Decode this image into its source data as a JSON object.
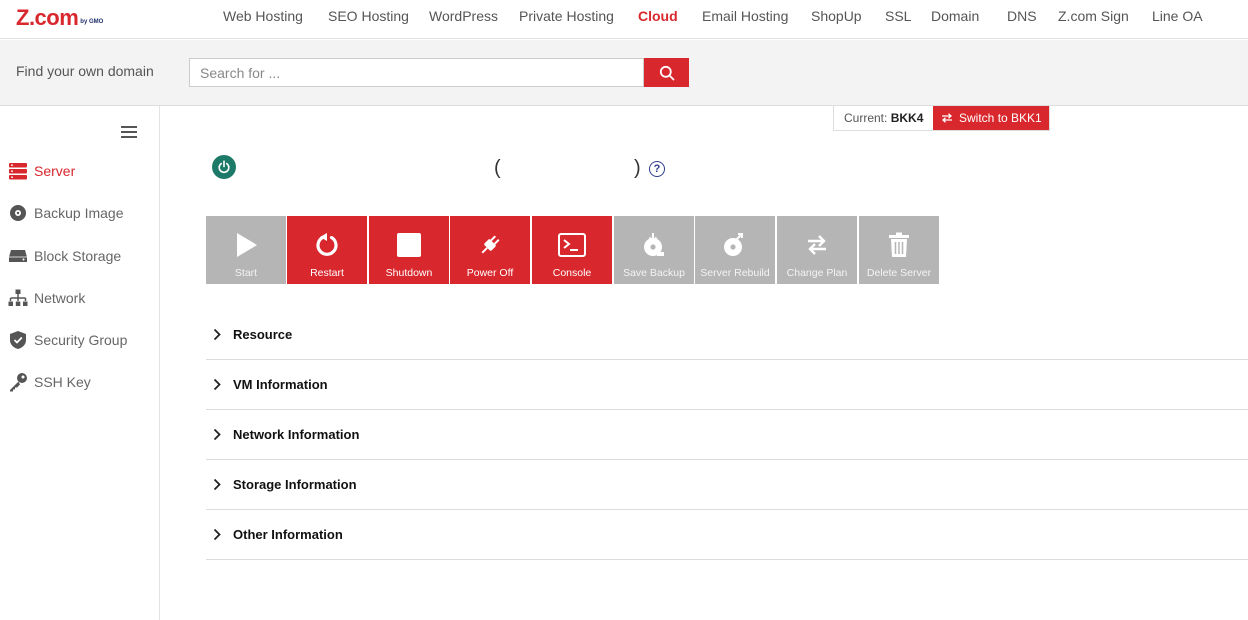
{
  "brand": {
    "logo": "Z.com",
    "logo_sub": "by GMO"
  },
  "nav": [
    {
      "label": "Web Hosting"
    },
    {
      "label": "SEO Hosting"
    },
    {
      "label": "WordPress"
    },
    {
      "label": "Private Hosting"
    },
    {
      "label": "Cloud",
      "active": true
    },
    {
      "label": "Email Hosting"
    },
    {
      "label": "ShopUp"
    },
    {
      "label": "SSL"
    },
    {
      "label": "Domain"
    },
    {
      "label": "DNS"
    },
    {
      "label": "Z.com Sign"
    },
    {
      "label": "Line OA"
    }
  ],
  "search": {
    "label": "Find your own domain",
    "placeholder": "Search for ..."
  },
  "sidebar": {
    "items": [
      {
        "label": "Server",
        "icon": "server-icon",
        "active": true
      },
      {
        "label": "Backup Image",
        "icon": "disc-icon"
      },
      {
        "label": "Block Storage",
        "icon": "storage-icon"
      },
      {
        "label": "Network",
        "icon": "network-icon"
      },
      {
        "label": "Security Group",
        "icon": "shield-icon"
      },
      {
        "label": "SSH Key",
        "icon": "key-icon"
      }
    ]
  },
  "region": {
    "current_label": "Current:",
    "current_value": "BKK4",
    "switch_label": "Switch to BKK1"
  },
  "server": {
    "paren_open": "(",
    "paren_close": ")",
    "help": "?"
  },
  "actions": [
    {
      "label": "Start",
      "icon": "play-icon",
      "enabled": false
    },
    {
      "label": "Restart",
      "icon": "restart-icon",
      "enabled": true
    },
    {
      "label": "Shutdown",
      "icon": "stop-icon",
      "enabled": true
    },
    {
      "label": "Power Off",
      "icon": "plug-icon",
      "enabled": true
    },
    {
      "label": "Console",
      "icon": "terminal-icon",
      "enabled": true
    },
    {
      "label": "Save Backup",
      "icon": "save-backup-icon",
      "enabled": false
    },
    {
      "label": "Server Rebuild",
      "icon": "rebuild-icon",
      "enabled": false
    },
    {
      "label": "Change Plan",
      "icon": "swap-icon",
      "enabled": false
    },
    {
      "label": "Delete Server",
      "icon": "trash-icon",
      "enabled": false
    }
  ],
  "sections": [
    {
      "title": "Resource"
    },
    {
      "title": "VM Information"
    },
    {
      "title": "Network Information"
    },
    {
      "title": "Storage Information"
    },
    {
      "title": "Other Information"
    }
  ],
  "colors": {
    "brand_red": "#d8272d",
    "disabled_grey": "#b5b5b5",
    "status_green": "#1e7a68",
    "help_blue": "#2e3d8f"
  }
}
